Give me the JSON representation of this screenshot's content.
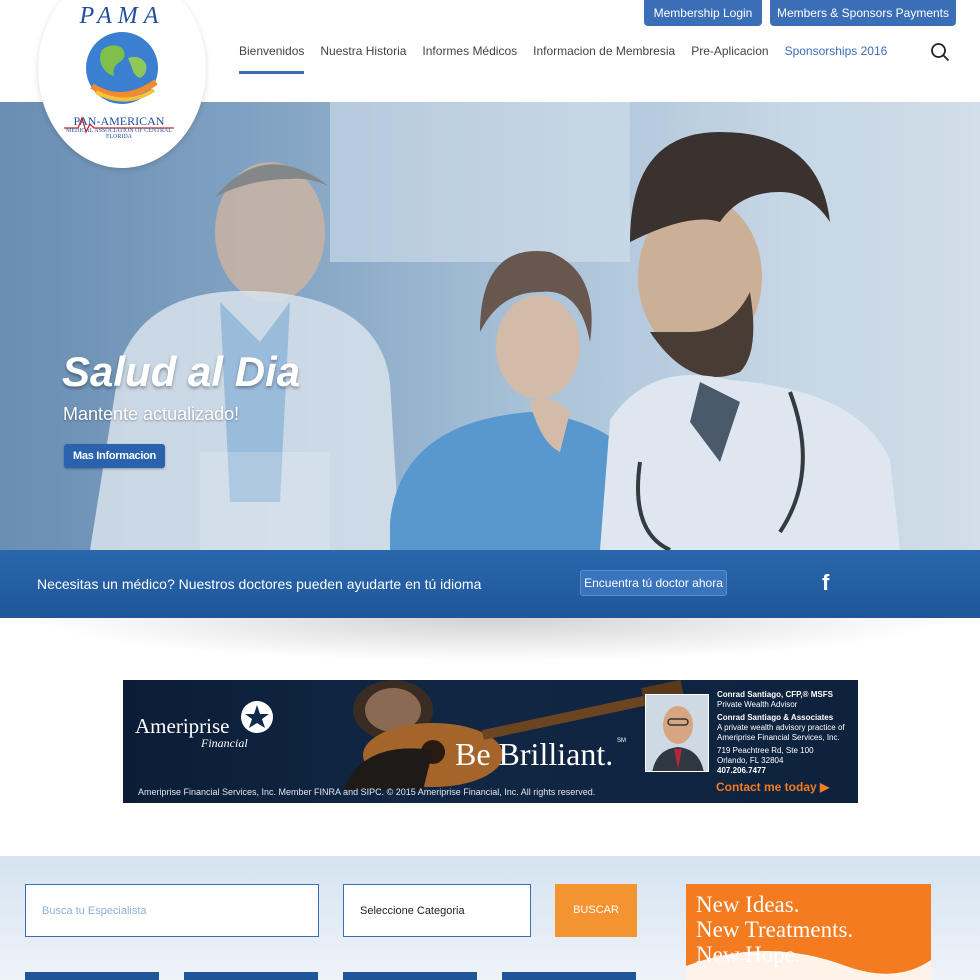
{
  "header": {
    "logo": {
      "acronym": "PAMA",
      "name": "PAN-AMERICAN",
      "subtitle": "MEDICAL ASSOCIATION OF CENTRAL FLORIDA"
    },
    "top_buttons": {
      "membership_login": "Membership Login",
      "payments": "Members & Sponsors Payments"
    },
    "nav": [
      {
        "label": "Bienvenidos",
        "active": true
      },
      {
        "label": "Nuestra Historia",
        "active": false
      },
      {
        "label": "Informes Médicos",
        "active": false
      },
      {
        "label": "Informacion de Membresia",
        "active": false
      },
      {
        "label": "Pre-Aplicacion",
        "active": false
      },
      {
        "label": "Sponsorships 2016",
        "active": false
      }
    ],
    "search_icon": "search-icon"
  },
  "hero": {
    "title": "Salud al Dia",
    "subtitle": "Mantente actualizado!",
    "button_label": "Mas Informacion"
  },
  "band": {
    "text": "Necesitas un médico? Nuestros doctores pueden ayudarte en tú idioma",
    "button_label": "Encuentra tú doctor ahora",
    "social_icon": "facebook-icon",
    "social_glyph": "f"
  },
  "ad": {
    "brand": "Ameriprise",
    "brand_line2": "Financial",
    "slogan": "Be Brilliant.",
    "slogan_mark": "SM",
    "advisor_name": "Conrad Santiago, CFP,® MSFS",
    "advisor_title": "Private Wealth Advisor",
    "firm": "Conrad Santiago & Associates",
    "firm_desc": "A private wealth advisory practice of Ameriprise Financial Services, Inc.",
    "address1": "719 Peachtree Rd, Ste 100",
    "address2": "Orlando, FL 32804",
    "phone": "407.206.7477",
    "cta": "Contact me today ▶",
    "legal": "Ameriprise Financial Services, Inc. Member FINRA and SIPC. © 2015 Ameriprise Financial, Inc. All rights reserved."
  },
  "search": {
    "placeholder": "Busca tu Especialista",
    "category_value": "Seleccione Categoria",
    "button_label": "BUSCAR"
  },
  "promo": {
    "line1": "New Ideas.",
    "line2": "New Treatments.",
    "line3": "New Hope."
  },
  "colors": {
    "brand_blue": "#3a6fb8",
    "band_blue": "#1f5699",
    "accent_orange": "#f49430"
  }
}
